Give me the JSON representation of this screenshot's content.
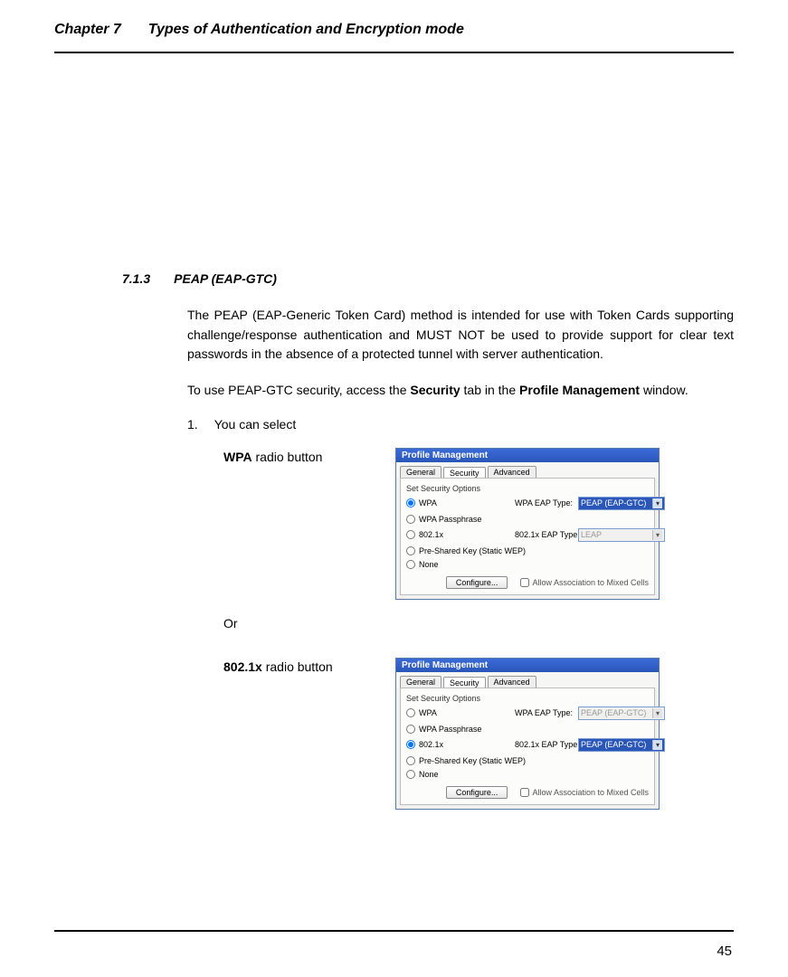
{
  "header": {
    "chapter": "Chapter 7",
    "title": "Types of Authentication and Encryption mode"
  },
  "section": {
    "number": "7.1.3",
    "title": "PEAP (EAP-GTC)"
  },
  "paragraphs": {
    "p1": "The PEAP (EAP-Generic Token Card) method is intended for use with Token Cards supporting challenge/response authentication and MUST NOT be used to provide support for clear text passwords in the absence of a protected tunnel with server authentication.",
    "p2_a": "To use PEAP-GTC security, access the ",
    "p2_b": "Security",
    "p2_c": " tab in the ",
    "p2_d": "Profile Management",
    "p2_e": " window."
  },
  "list": {
    "num": "1.",
    "text": "You can select"
  },
  "options": {
    "wpa_b": "WPA",
    "wpa_t": " radio button",
    "or": "Or",
    "dot1x_b": "802.1x",
    "dot1x_t": " radio button"
  },
  "dlg": {
    "title": "Profile Management",
    "tabs": {
      "general": "General",
      "security": "Security",
      "advanced": "Advanced"
    },
    "fieldset": "Set Security Options",
    "radios": {
      "wpa": "WPA",
      "wpa_pass": "WPA Passphrase",
      "dot1x": "802.1x",
      "psk": "Pre-Shared Key (Static WEP)",
      "none": "None"
    },
    "labels": {
      "wpa_eap": "WPA EAP Type:",
      "dot1x_eap": "802.1x EAP Type:"
    },
    "combos": {
      "peap": "PEAP (EAP-GTC)",
      "leap": "LEAP"
    },
    "config_btn": "Configure...",
    "allow_chk": "Allow Association to Mixed Cells"
  },
  "page_number": "45"
}
